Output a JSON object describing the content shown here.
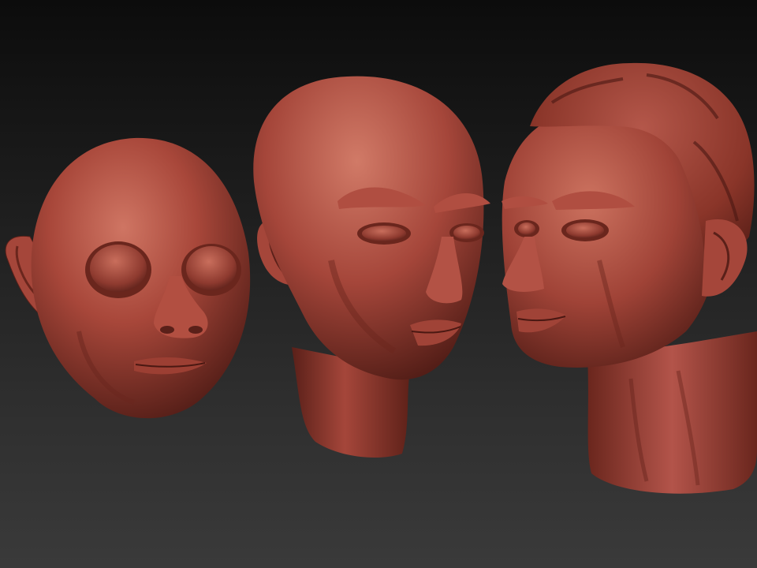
{
  "scene": {
    "background_top": "#0c0c0c",
    "background_bottom": "#3a3a3a",
    "material_color": "#a8473a",
    "material_shadow": "#4a1a14",
    "material_highlight": "#d27a68"
  },
  "sculpts": [
    {
      "name": "childlike-head",
      "has_ears": true,
      "has_hair": false,
      "has_neck": false
    },
    {
      "name": "bald-head",
      "has_ears": true,
      "has_hair": false,
      "has_neck": true
    },
    {
      "name": "haired-bust",
      "has_ears": true,
      "has_hair": true,
      "has_neck": true
    }
  ]
}
